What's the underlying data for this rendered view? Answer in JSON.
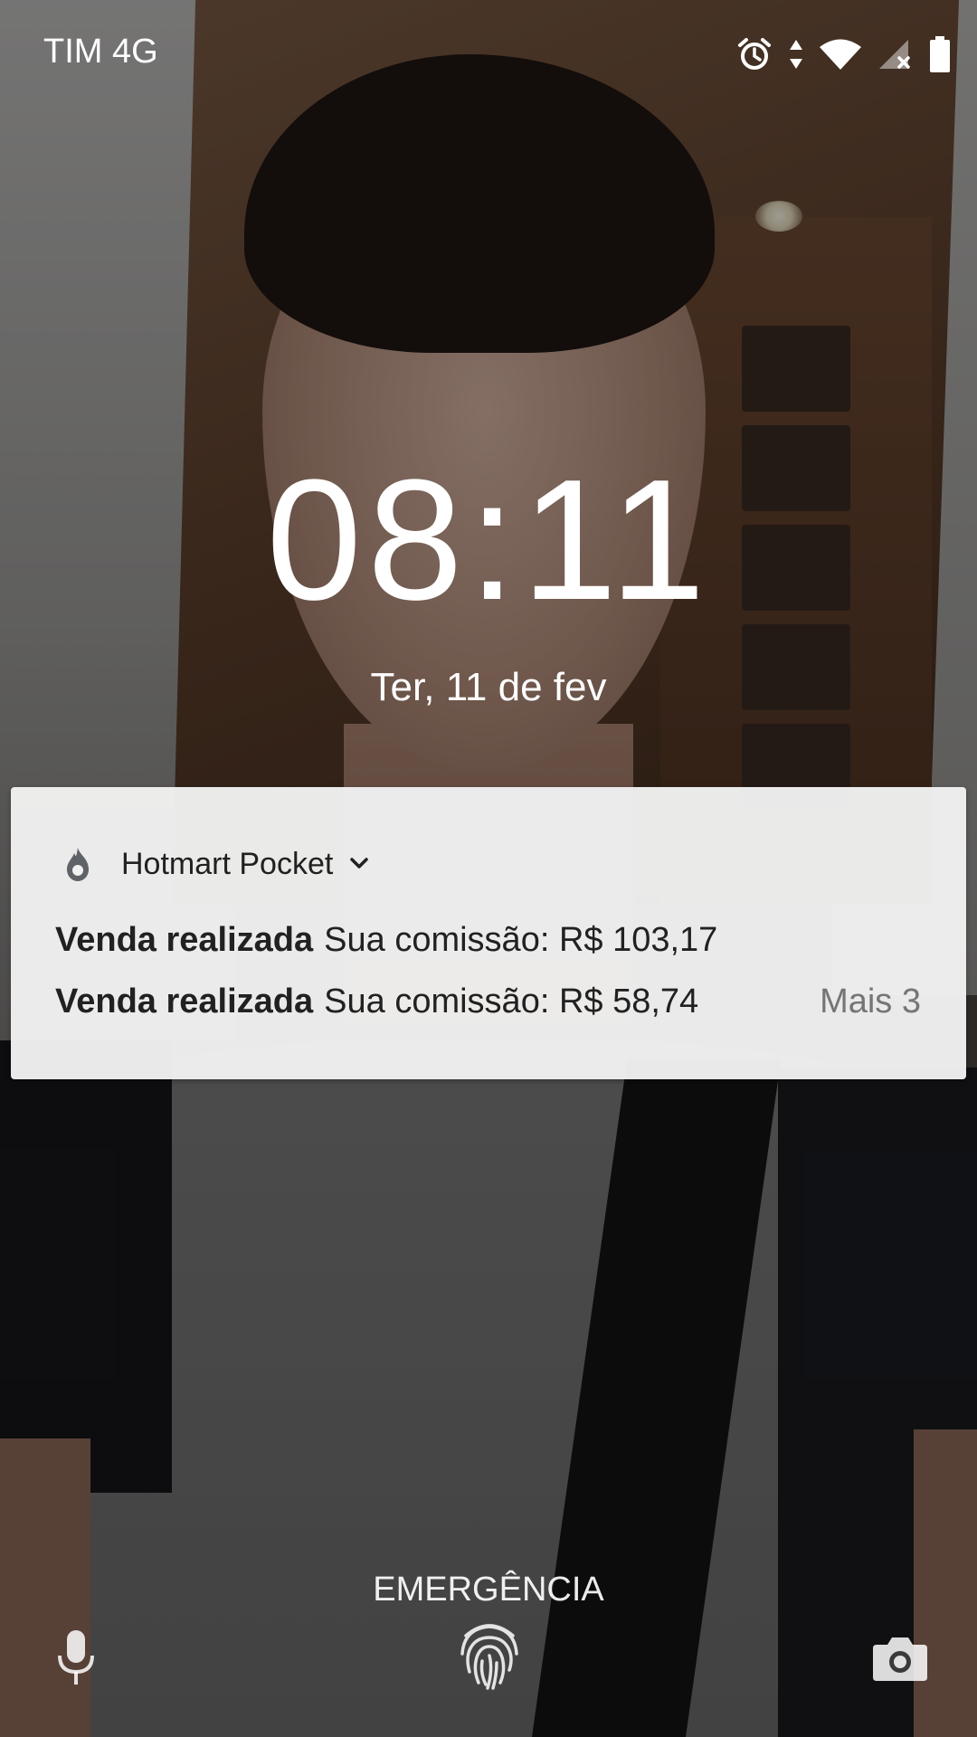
{
  "status_bar": {
    "carrier": "TIM 4G",
    "icons": [
      "alarm-icon",
      "data-arrows-icon",
      "wifi-icon",
      "cell-signal-no-service-icon",
      "battery-icon"
    ]
  },
  "lock_screen": {
    "time": "08:11",
    "date": "Ter, 11 de fev"
  },
  "notification": {
    "app_icon": "hotmart-flame-icon",
    "app_name": "Hotmart Pocket",
    "expand_icon": "chevron-down-icon",
    "messages": [
      {
        "title": "Venda realizada",
        "body": "Sua comissão: R$ 103,17"
      },
      {
        "title": "Venda realizada",
        "body": "Sua comissão: R$ 58,74"
      }
    ],
    "more_label": "Mais 3"
  },
  "bottom": {
    "emergency_label": "EMERGÊNCIA",
    "left_shortcut": "microphone-icon",
    "center": "fingerprint-icon",
    "right_shortcut": "camera-icon"
  }
}
